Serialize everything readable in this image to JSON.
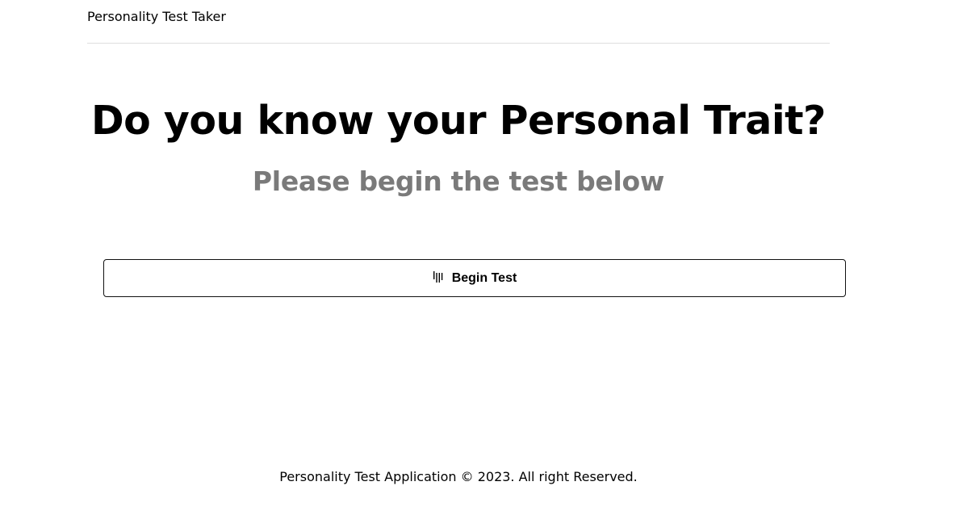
{
  "header": {
    "brand": "Personality Test Taker"
  },
  "hero": {
    "title": "Do you know your Personal Trait?",
    "subtitle": "Please begin the test below"
  },
  "actions": {
    "begin_label": "Begin Test",
    "begin_icon": "stack-bars-icon"
  },
  "footer": {
    "copyright": "Personality Test Application © 2023. All right Reserved."
  },
  "colors": {
    "text": "#000000",
    "subtitle": "#7a7a7a",
    "divider": "#dedede",
    "button_border": "#111111",
    "background": "#ffffff"
  }
}
